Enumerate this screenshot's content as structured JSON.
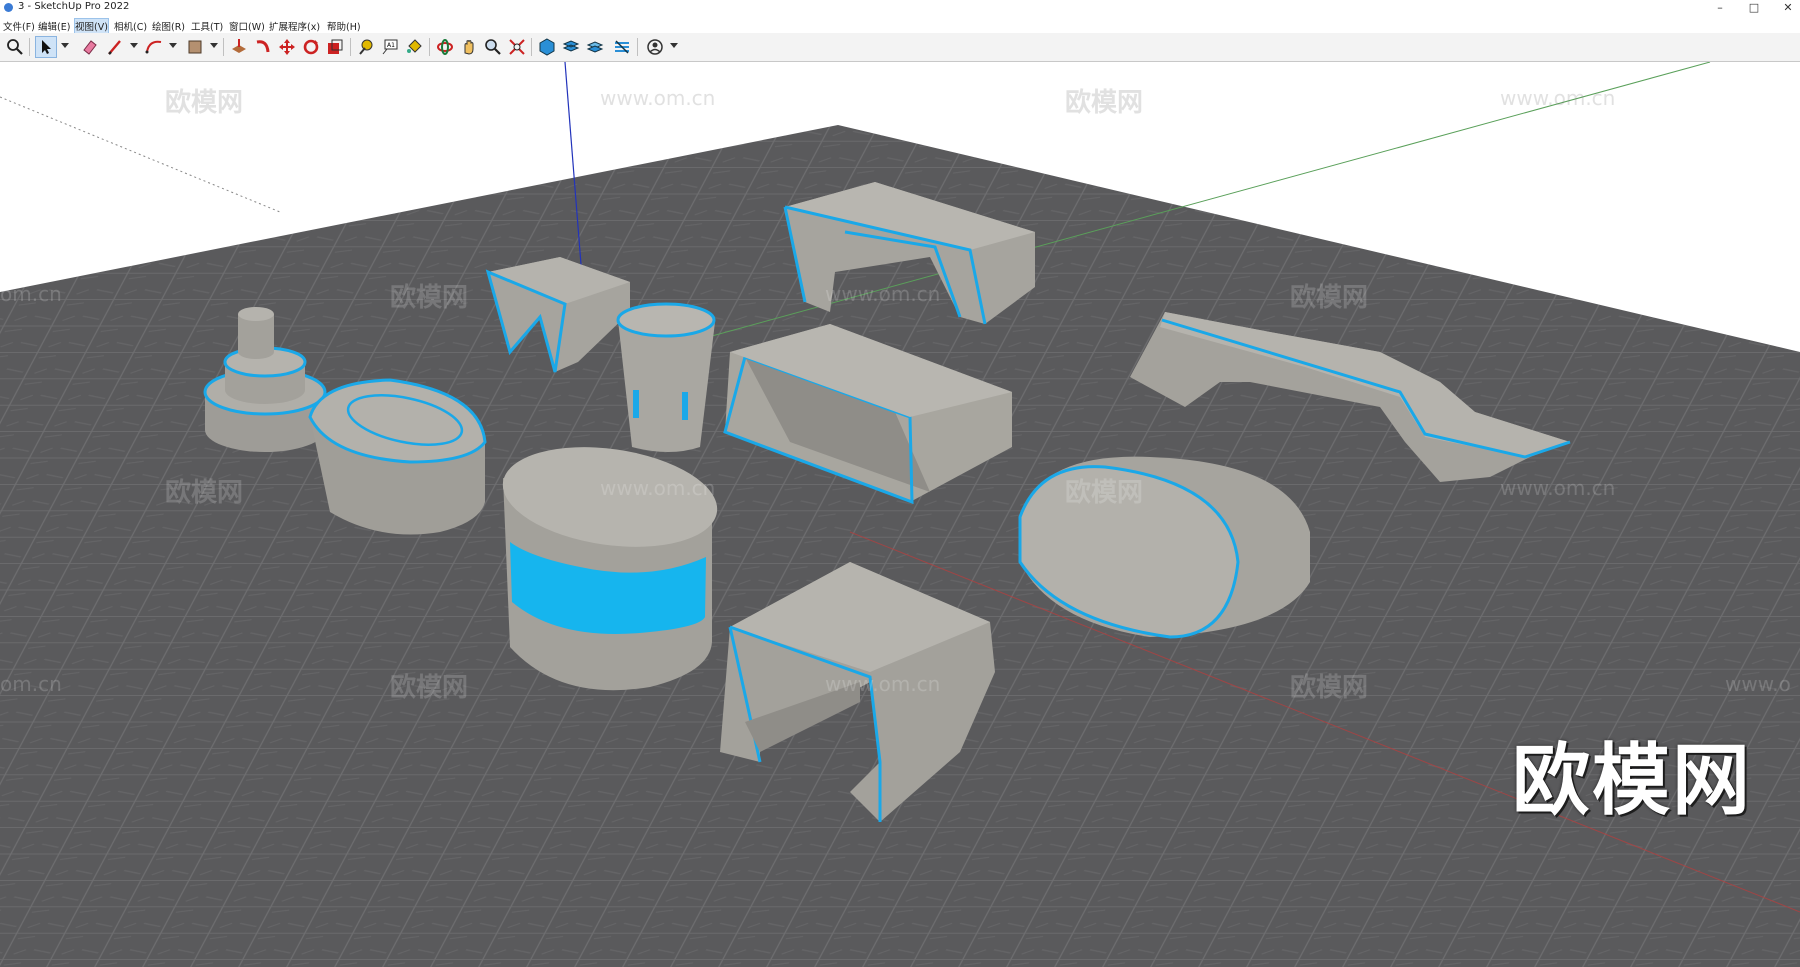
{
  "window": {
    "title": "3 - SketchUp Pro 2022"
  },
  "menu": [
    "文件(F)",
    "编辑(E)",
    "视图(V)",
    "相机(C)",
    "绘图(R)",
    "工具(T)",
    "窗口(W)",
    "扩展程序(x)",
    "帮助(H)"
  ],
  "menu_active": "视图(V)",
  "toolbar": {
    "tools": [
      "zoom-icon",
      "select-icon",
      "eraser-icon",
      "pencil-line-icon",
      "arc-icon",
      "rectangle-icon",
      "push-pull-icon",
      "follow-me-icon",
      "move-icon",
      "rotate-icon",
      "scale-icon",
      "tape-measure-icon",
      "text-icon",
      "paint-bucket-icon",
      "orbit-icon",
      "pan-icon",
      "zoom-icon",
      "zoom-extents-icon",
      "components-icon",
      "styles-icon",
      "layers-icon",
      "scenes-icon",
      "account-icon"
    ]
  },
  "watermarks": {
    "brand": "欧模网",
    "url": "www.om.cn",
    "url_fragment": "om.cn",
    "url_edge": "www.o"
  },
  "logo": "欧模网",
  "colors": {
    "accent": "#1aa8e8",
    "model_face": "#a9a7a1",
    "model_dark": "#8d8b86",
    "floor": "#5d5d5f"
  }
}
